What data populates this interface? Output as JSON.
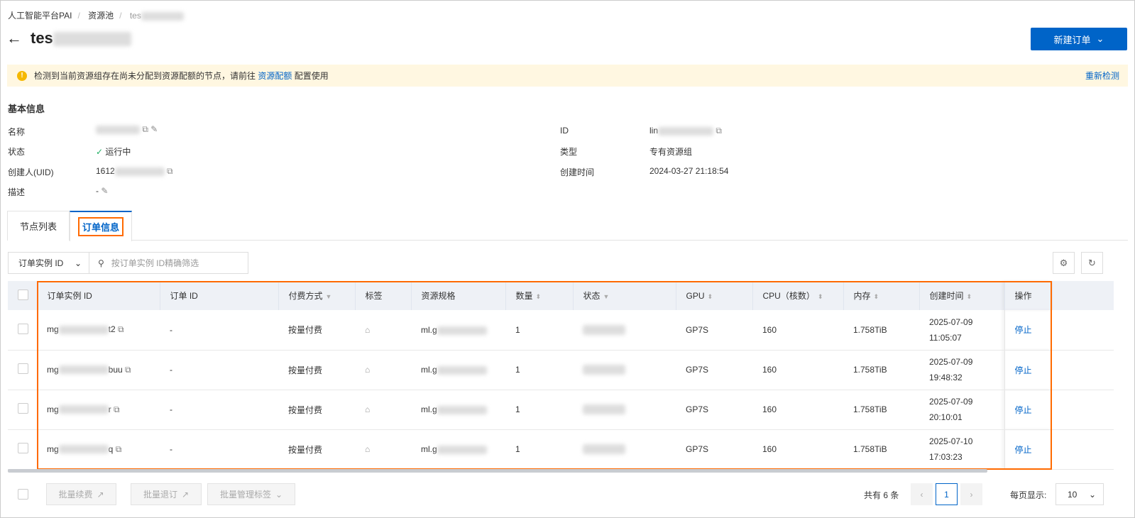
{
  "breadcrumb": [
    "人工智能平台PAI",
    "资源池",
    "tes"
  ],
  "page_title": "tes",
  "new_order_button": "新建订单",
  "alert": {
    "text": "检测到当前资源组存在尚未分配到资源配额的节点，请前往",
    "link": "资源配额",
    "suffix": "配置使用",
    "recheck": "重新检测"
  },
  "basic": {
    "title": "基本信息",
    "name_label": "名称",
    "status_label": "状态",
    "status_value": "运行中",
    "creator_label": "创建人(UID)",
    "creator_value": "1612",
    "desc_label": "描述",
    "desc_value": "-",
    "id_label": "ID",
    "id_value": "lin",
    "type_label": "类型",
    "type_value": "专有资源组",
    "created_label": "创建时间",
    "created_value": "2024-03-27 21:18:54"
  },
  "tabs": [
    "节点列表",
    "订单信息"
  ],
  "filter": {
    "select": "订单实例 ID",
    "placeholder": "按订单实例 ID精确筛选"
  },
  "table": {
    "headers": [
      "订单实例 ID",
      "订单 ID",
      "付费方式",
      "标签",
      "资源规格",
      "数量",
      "状态",
      "GPU",
      "CPU（核数）",
      "内存",
      "创建时间",
      "操作"
    ],
    "rows": [
      {
        "inst_pre": "mg",
        "inst_suf": "t2",
        "order": "-",
        "pay": "按量付费",
        "spec": "ml.g",
        "qty": "1",
        "gpu": "GP7S",
        "cpu": "160",
        "mem": "1.758TiB",
        "date": "2025-07-09",
        "time": "11:05:07",
        "action": "停止"
      },
      {
        "inst_pre": "mg",
        "inst_suf": "buu",
        "order": "-",
        "pay": "按量付费",
        "spec": "ml.g",
        "qty": "1",
        "gpu": "GP7S",
        "cpu": "160",
        "mem": "1.758TiB",
        "date": "2025-07-09",
        "time": "19:48:32",
        "action": "停止"
      },
      {
        "inst_pre": "mg",
        "inst_suf": "r",
        "order": "-",
        "pay": "按量付费",
        "spec": "ml.g",
        "qty": "1",
        "gpu": "GP7S",
        "cpu": "160",
        "mem": "1.758TiB",
        "date": "2025-07-09",
        "time": "20:10:01",
        "action": "停止"
      },
      {
        "inst_pre": "mg",
        "inst_suf": "q",
        "order": "-",
        "pay": "按量付费",
        "spec": "ml.g",
        "qty": "1",
        "gpu": "GP7S",
        "cpu": "160",
        "mem": "1.758TiB",
        "date": "2025-07-10",
        "time": "17:03:23",
        "action": "停止"
      }
    ]
  },
  "footer": {
    "batch_renew": "批量续费",
    "batch_unsub": "批量退订",
    "batch_tags": "批量管理标签",
    "total": "共有 6 条",
    "page": "1",
    "per_page_label": "每页显示:",
    "per_page": "10"
  }
}
